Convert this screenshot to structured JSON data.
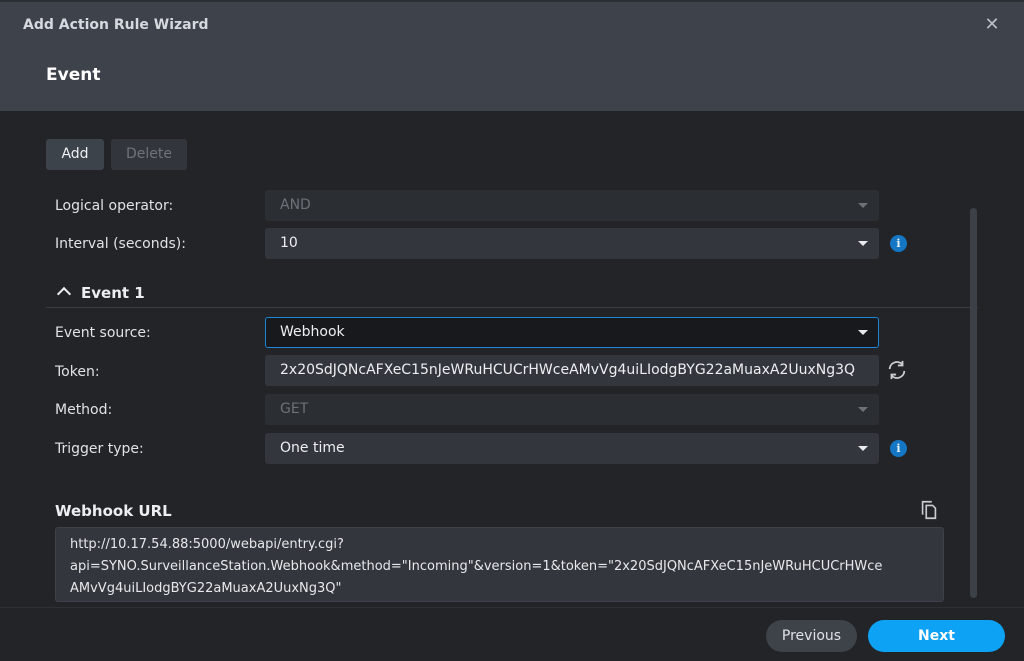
{
  "window": {
    "title": "Add Action Rule Wizard",
    "close_icon": "close-icon"
  },
  "step": {
    "title": "Event"
  },
  "toolbar": {
    "add_label": "Add",
    "delete_label": "Delete"
  },
  "general": {
    "logical_operator": {
      "label": "Logical operator:",
      "value": "AND",
      "disabled": true
    },
    "interval": {
      "label": "Interval (seconds):",
      "value": "10",
      "info_icon": "info-icon"
    }
  },
  "event1": {
    "title": "Event 1",
    "expanded": true,
    "event_source": {
      "label": "Event source:",
      "value": "Webhook"
    },
    "token": {
      "label": "Token:",
      "value": "2x20SdJQNcAFXeC15nJeWRuHCUCrHWceAMvVg4uiLIodgBYG22aMuaxA2UuxNg3Q",
      "refresh_icon": "refresh-icon"
    },
    "method": {
      "label": "Method:",
      "value": "GET",
      "disabled": true
    },
    "trigger_type": {
      "label": "Trigger type:",
      "value": "One time",
      "info_icon": "info-icon"
    }
  },
  "webhook_url": {
    "title": "Webhook URL",
    "copy_icon": "copy-icon",
    "lines": [
      "http://10.17.54.88:5000/webapi/entry.cgi?",
      "api=SYNO.SurveillanceStation.Webhook&method=\"Incoming\"&version=1&token=\"2x20SdJQNcAFXeC15nJeWRuHCUCrHWce",
      "AMvVg4uiLIodgBYG22aMuaxA2UuxNg3Q\""
    ]
  },
  "footer": {
    "previous_label": "Previous",
    "next_label": "Next"
  },
  "colors": {
    "accent": "#0da2f4",
    "focus_border": "#1e86d6",
    "info": "#1577c4",
    "header_bg": "#3d424b",
    "body_bg": "#222428"
  }
}
